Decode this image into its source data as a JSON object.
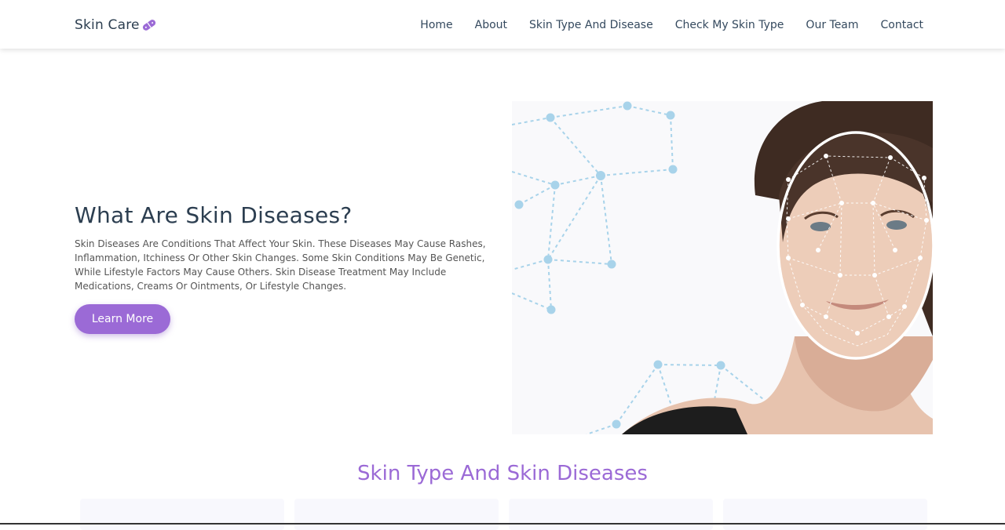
{
  "nav": {
    "brand": "Skin Care",
    "links": [
      "Home",
      "About",
      "Skin Type And Disease",
      "Check My Skin Type",
      "Our Team",
      "Contact"
    ]
  },
  "hero": {
    "title": "What Are Skin Diseases?",
    "description": "Skin Diseases Are Conditions That Affect Your Skin. These Diseases May Cause Rashes, Inflammation, Itchiness Or Other Skin Changes. Some Skin Conditions May Be Genetic, While Lifestyle Factors May Cause Others. Skin Disease Treatment May Include Medications, Creams Or Ointments, Or Lifestyle Changes.",
    "button": "Learn More"
  },
  "section": {
    "title": "Skin Type And Skin Diseases"
  },
  "colors": {
    "accent": "#9b6ad6",
    "heading": "#2c3e50",
    "network_dots": "#a8d3ea"
  },
  "icons": {
    "brand": "pill-icon"
  }
}
